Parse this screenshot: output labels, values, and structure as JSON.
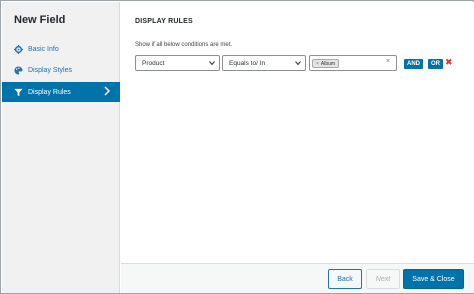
{
  "sidebar": {
    "title": "New Field",
    "items": [
      {
        "label": "Basic Info",
        "icon": "gear-icon",
        "active": false
      },
      {
        "label": "Display Styles",
        "icon": "palette-icon",
        "active": false
      },
      {
        "label": "Display Rules",
        "icon": "filter-icon",
        "active": true
      }
    ]
  },
  "main": {
    "title": "DISPLAY RULES",
    "hint": "Show if all below conditions are met.",
    "rule": {
      "field_value": "Product",
      "operator_value": "Equals to/ In",
      "tags": [
        "Album"
      ],
      "tag_remove_symbol": "×",
      "clear_symbol": "×",
      "and_label": "AND",
      "or_label": "OR",
      "remove_symbol": "✖"
    }
  },
  "footer": {
    "back_label": "Back",
    "next_label": "Next",
    "save_label": "Save & Close"
  },
  "colors": {
    "accent": "#0073aa",
    "sidebar_bg": "#f1f1f1",
    "danger": "#d63638"
  }
}
